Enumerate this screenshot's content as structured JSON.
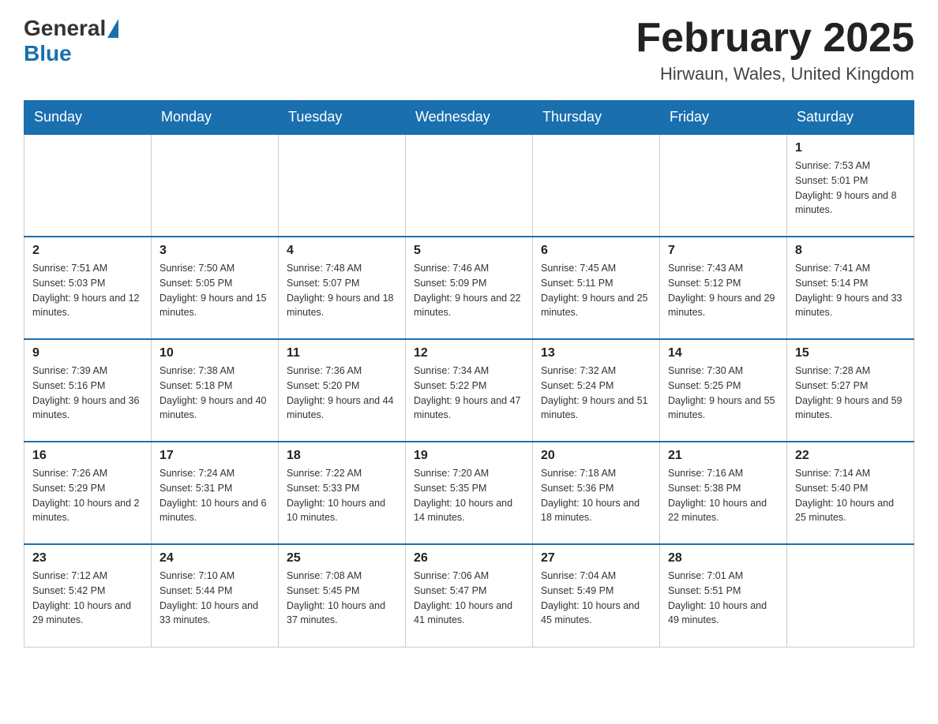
{
  "header": {
    "logo_general": "General",
    "logo_blue": "Blue",
    "month_title": "February 2025",
    "location": "Hirwaun, Wales, United Kingdom"
  },
  "days_of_week": [
    "Sunday",
    "Monday",
    "Tuesday",
    "Wednesday",
    "Thursday",
    "Friday",
    "Saturday"
  ],
  "weeks": [
    {
      "days": [
        {
          "num": "",
          "info": ""
        },
        {
          "num": "",
          "info": ""
        },
        {
          "num": "",
          "info": ""
        },
        {
          "num": "",
          "info": ""
        },
        {
          "num": "",
          "info": ""
        },
        {
          "num": "",
          "info": ""
        },
        {
          "num": "1",
          "info": "Sunrise: 7:53 AM\nSunset: 5:01 PM\nDaylight: 9 hours and 8 minutes."
        }
      ]
    },
    {
      "days": [
        {
          "num": "2",
          "info": "Sunrise: 7:51 AM\nSunset: 5:03 PM\nDaylight: 9 hours and 12 minutes."
        },
        {
          "num": "3",
          "info": "Sunrise: 7:50 AM\nSunset: 5:05 PM\nDaylight: 9 hours and 15 minutes."
        },
        {
          "num": "4",
          "info": "Sunrise: 7:48 AM\nSunset: 5:07 PM\nDaylight: 9 hours and 18 minutes."
        },
        {
          "num": "5",
          "info": "Sunrise: 7:46 AM\nSunset: 5:09 PM\nDaylight: 9 hours and 22 minutes."
        },
        {
          "num": "6",
          "info": "Sunrise: 7:45 AM\nSunset: 5:11 PM\nDaylight: 9 hours and 25 minutes."
        },
        {
          "num": "7",
          "info": "Sunrise: 7:43 AM\nSunset: 5:12 PM\nDaylight: 9 hours and 29 minutes."
        },
        {
          "num": "8",
          "info": "Sunrise: 7:41 AM\nSunset: 5:14 PM\nDaylight: 9 hours and 33 minutes."
        }
      ]
    },
    {
      "days": [
        {
          "num": "9",
          "info": "Sunrise: 7:39 AM\nSunset: 5:16 PM\nDaylight: 9 hours and 36 minutes."
        },
        {
          "num": "10",
          "info": "Sunrise: 7:38 AM\nSunset: 5:18 PM\nDaylight: 9 hours and 40 minutes."
        },
        {
          "num": "11",
          "info": "Sunrise: 7:36 AM\nSunset: 5:20 PM\nDaylight: 9 hours and 44 minutes."
        },
        {
          "num": "12",
          "info": "Sunrise: 7:34 AM\nSunset: 5:22 PM\nDaylight: 9 hours and 47 minutes."
        },
        {
          "num": "13",
          "info": "Sunrise: 7:32 AM\nSunset: 5:24 PM\nDaylight: 9 hours and 51 minutes."
        },
        {
          "num": "14",
          "info": "Sunrise: 7:30 AM\nSunset: 5:25 PM\nDaylight: 9 hours and 55 minutes."
        },
        {
          "num": "15",
          "info": "Sunrise: 7:28 AM\nSunset: 5:27 PM\nDaylight: 9 hours and 59 minutes."
        }
      ]
    },
    {
      "days": [
        {
          "num": "16",
          "info": "Sunrise: 7:26 AM\nSunset: 5:29 PM\nDaylight: 10 hours and 2 minutes."
        },
        {
          "num": "17",
          "info": "Sunrise: 7:24 AM\nSunset: 5:31 PM\nDaylight: 10 hours and 6 minutes."
        },
        {
          "num": "18",
          "info": "Sunrise: 7:22 AM\nSunset: 5:33 PM\nDaylight: 10 hours and 10 minutes."
        },
        {
          "num": "19",
          "info": "Sunrise: 7:20 AM\nSunset: 5:35 PM\nDaylight: 10 hours and 14 minutes."
        },
        {
          "num": "20",
          "info": "Sunrise: 7:18 AM\nSunset: 5:36 PM\nDaylight: 10 hours and 18 minutes."
        },
        {
          "num": "21",
          "info": "Sunrise: 7:16 AM\nSunset: 5:38 PM\nDaylight: 10 hours and 22 minutes."
        },
        {
          "num": "22",
          "info": "Sunrise: 7:14 AM\nSunset: 5:40 PM\nDaylight: 10 hours and 25 minutes."
        }
      ]
    },
    {
      "days": [
        {
          "num": "23",
          "info": "Sunrise: 7:12 AM\nSunset: 5:42 PM\nDaylight: 10 hours and 29 minutes."
        },
        {
          "num": "24",
          "info": "Sunrise: 7:10 AM\nSunset: 5:44 PM\nDaylight: 10 hours and 33 minutes."
        },
        {
          "num": "25",
          "info": "Sunrise: 7:08 AM\nSunset: 5:45 PM\nDaylight: 10 hours and 37 minutes."
        },
        {
          "num": "26",
          "info": "Sunrise: 7:06 AM\nSunset: 5:47 PM\nDaylight: 10 hours and 41 minutes."
        },
        {
          "num": "27",
          "info": "Sunrise: 7:04 AM\nSunset: 5:49 PM\nDaylight: 10 hours and 45 minutes."
        },
        {
          "num": "28",
          "info": "Sunrise: 7:01 AM\nSunset: 5:51 PM\nDaylight: 10 hours and 49 minutes."
        },
        {
          "num": "",
          "info": ""
        }
      ]
    }
  ]
}
